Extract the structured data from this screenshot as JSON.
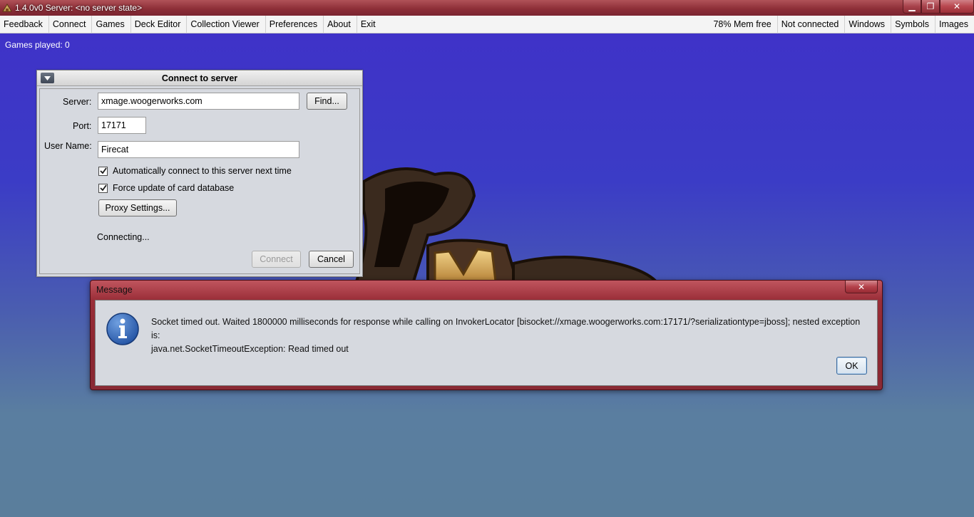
{
  "window": {
    "title": "1.4.0v0  Server: <no server state>",
    "min": "▁",
    "max": "❐",
    "close": "✕"
  },
  "menubar": {
    "left": [
      "Feedback",
      "Connect",
      "Games",
      "Deck Editor",
      "Collection Viewer",
      "Preferences",
      "About",
      "Exit"
    ],
    "mem": "78% Mem free",
    "status": "Not connected",
    "right": [
      "Windows",
      "Symbols",
      "Images"
    ]
  },
  "games_played": "Games played: 0",
  "connect_dialog": {
    "title": "Connect to server",
    "server_label": "Server:",
    "server_value": "xmage.woogerworks.com",
    "find_button": "Find...",
    "port_label": "Port:",
    "port_value": "17171",
    "username_label": "User Name:",
    "username_value": "Firecat",
    "auto_connect": "Automatically connect to this server next time",
    "auto_connect_checked": true,
    "force_update": "Force update of card database",
    "force_update_checked": true,
    "proxy_button": "Proxy Settings...",
    "status": "Connecting...",
    "connect_button": "Connect",
    "cancel_button": "Cancel"
  },
  "message_dialog": {
    "title": "Message",
    "close": "✕",
    "line1": "Socket timed out.  Waited 1800000 milliseconds for response while calling on InvokerLocator [bisocket://xmage.woogerworks.com:17171/?serializationtype=jboss]; nested exception is:",
    "line2": "java.net.SocketTimeoutException: Read timed out",
    "ok_button": "OK",
    "icon": "info-icon"
  },
  "colors": {
    "accent_titlebar": "#8e2f38",
    "background_top": "#4030c8",
    "background_bottom": "#5a7e9c",
    "dialog_bg": "#d6d9df",
    "info_blue": "#2f5fb0"
  }
}
